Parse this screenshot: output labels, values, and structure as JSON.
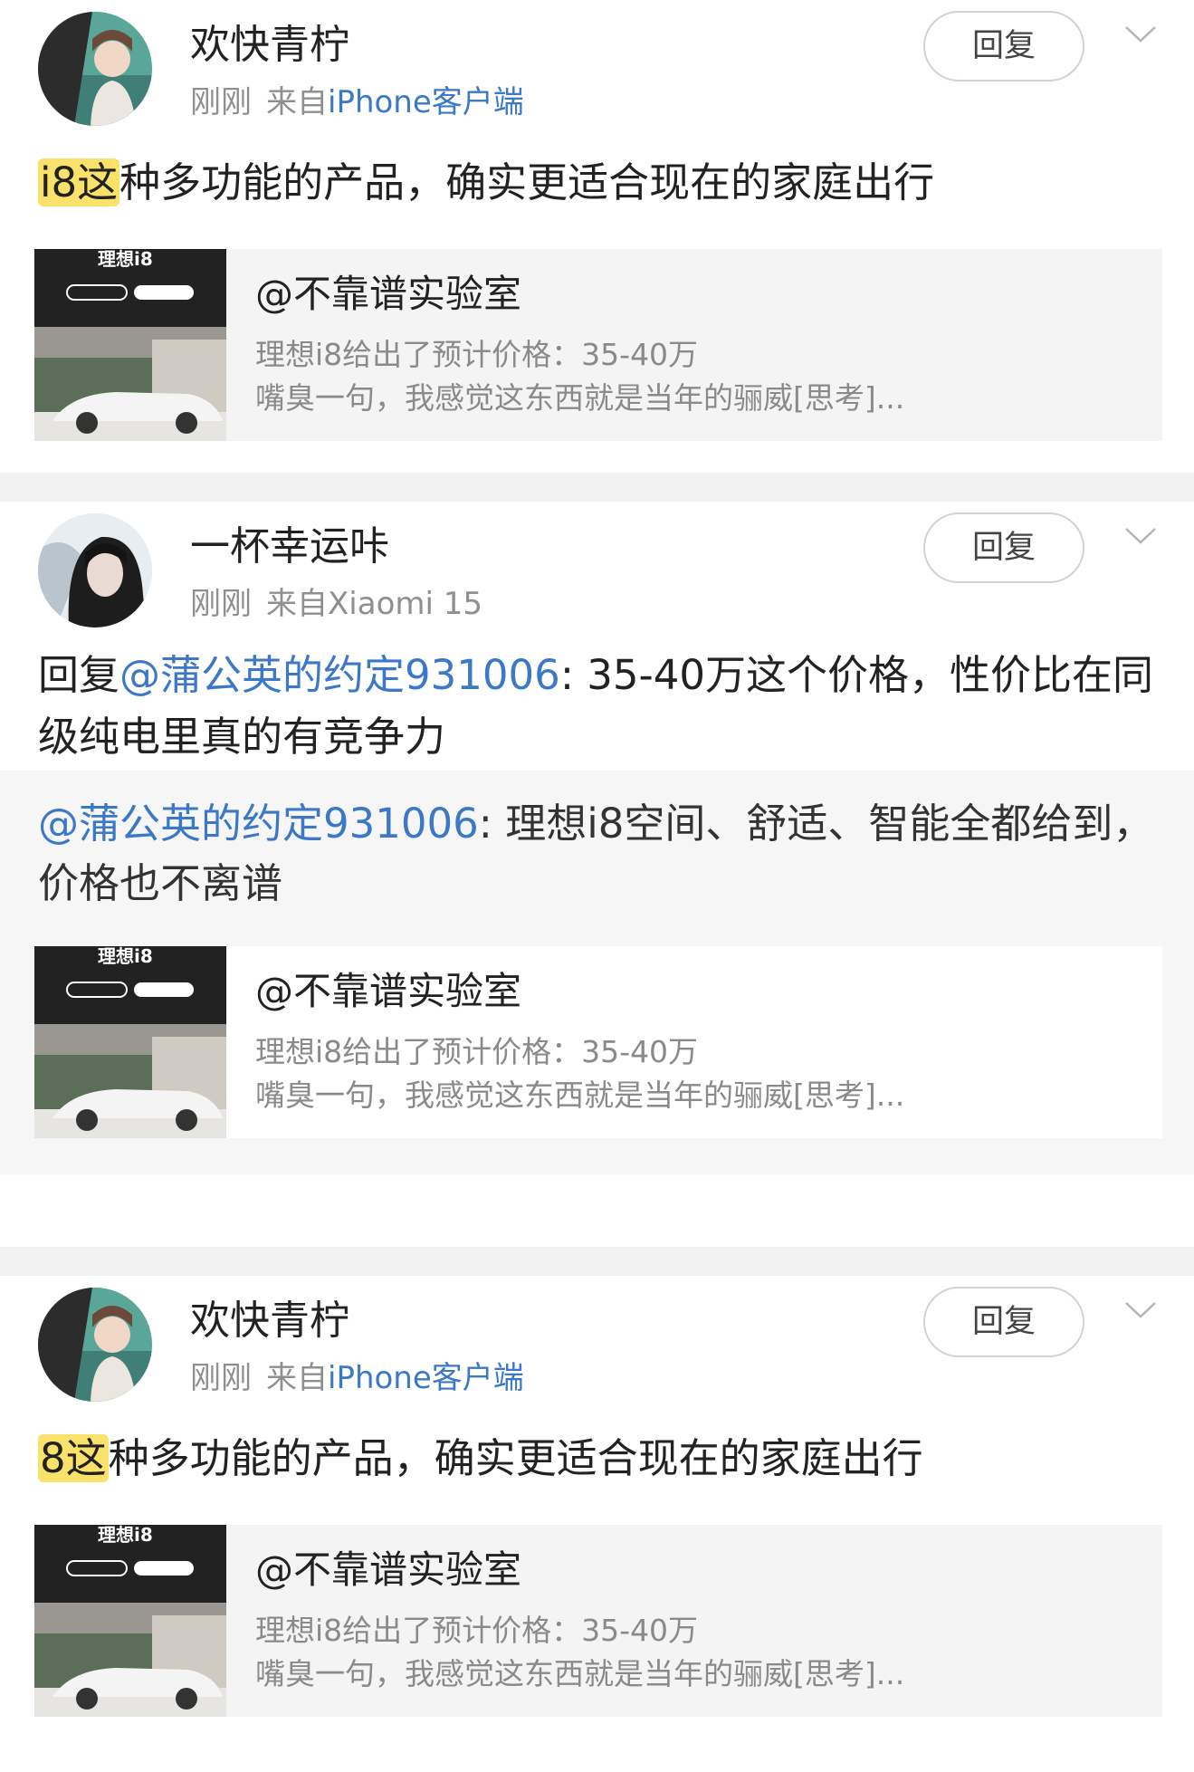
{
  "comments": [
    {
      "username": "欢快青柠",
      "time": "刚刚",
      "source_prefix": "来自",
      "client": "iPhone客户端",
      "reply_label": "回复",
      "highlight": "i8这",
      "text_rest": "种多功能的产品，确实更适合现在的家庭出行",
      "link": {
        "thumb_title": "理想i8",
        "title": "@不靠谱实验室",
        "line1": "理想i8给出了预计价格：35-40万",
        "line2": "嘴臭一句，我感觉这东西就是当年的骊威[思考]..."
      }
    },
    {
      "username": "一杯幸运咔",
      "time": "刚刚",
      "source_prefix": "来自",
      "client": "Xiaomi 15",
      "reply_label": "回复",
      "reply_prefix": "回复",
      "mention": "@蒲公英的约定931006",
      "text_rest": ": 35-40万这个价格，性价比在同级纯电里真的有竞争力",
      "quote": {
        "mention": "@蒲公英的约定931006",
        "text": ": 理想i8空间、舒适、智能全都给到，价格也不离谱",
        "link": {
          "thumb_title": "理想i8",
          "title": "@不靠谱实验室",
          "line1": "理想i8给出了预计价格：35-40万",
          "line2": "嘴臭一句，我感觉这东西就是当年的骊威[思考]..."
        }
      }
    },
    {
      "username": "欢快青柠",
      "time": "刚刚",
      "source_prefix": "来自",
      "client": "iPhone客户端",
      "reply_label": "回复",
      "highlight": "8这",
      "text_rest": "种多功能的产品，确实更适合现在的家庭出行",
      "link": {
        "thumb_title": "理想i8",
        "title": "@不靠谱实验室",
        "line1": "理想i8给出了预计价格：35-40万",
        "line2": "嘴臭一句，我感觉这东西就是当年的骊威[思考]..."
      }
    }
  ],
  "colors": {
    "link_blue": "#3c78c8",
    "highlight_yellow": "#fae26a",
    "meta_gray": "#8f8f8f",
    "divider_gray": "#f2f2f2"
  },
  "icons": {
    "more": "chevron-down-icon"
  }
}
